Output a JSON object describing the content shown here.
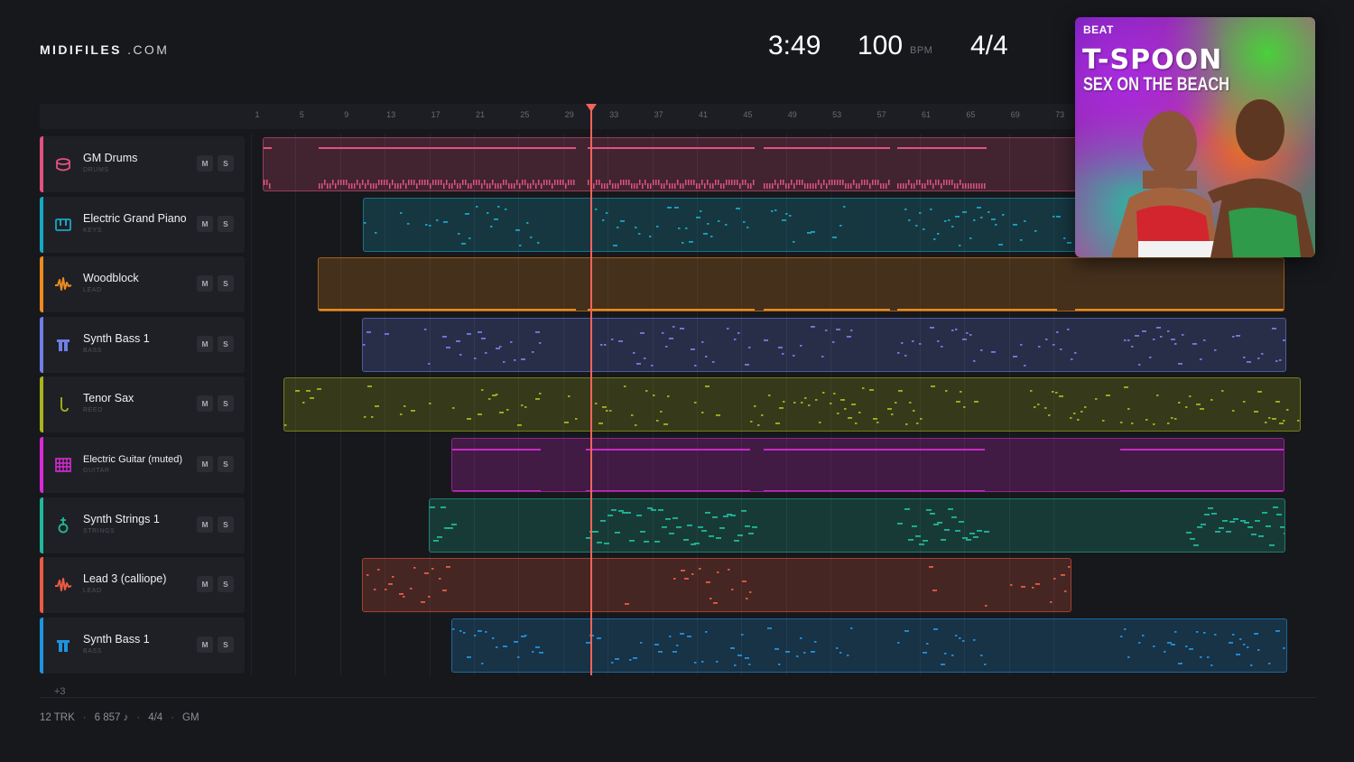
{
  "header": {
    "logo_brand": "MIDIFILES",
    "logo_tld": ".COM",
    "time": "3:49",
    "bpm": "100",
    "bpm_label": "BPM",
    "time_signature": "4/4"
  },
  "ruler": {
    "ticks": [
      "1",
      "5",
      "9",
      "13",
      "17",
      "21",
      "25",
      "29",
      "33",
      "37",
      "41",
      "45",
      "49",
      "53",
      "57",
      "61",
      "65",
      "69",
      "73"
    ]
  },
  "playhead": {
    "bar": 30.5
  },
  "tracks": [
    {
      "name": "GM Drums",
      "category": "DRUMS",
      "color": "#e0527e",
      "icon": "drum-icon",
      "mute": "M",
      "solo": "S"
    },
    {
      "name": "Electric Grand Piano",
      "category": "KEYS",
      "color": "#17a7c4",
      "icon": "piano-icon",
      "mute": "M",
      "solo": "S"
    },
    {
      "name": "Woodblock",
      "category": "LEAD",
      "color": "#ec8a1e",
      "icon": "wave-icon",
      "mute": "M",
      "solo": "S"
    },
    {
      "name": "Synth Bass 1",
      "category": "BASS",
      "color": "#6f7fe6",
      "icon": "bass-icon",
      "mute": "M",
      "solo": "S"
    },
    {
      "name": "Tenor Sax",
      "category": "REED",
      "color": "#a7b41c",
      "icon": "sax-icon",
      "mute": "M",
      "solo": "S"
    },
    {
      "name": "Electric Guitar (muted)",
      "category": "GUITAR",
      "color": "#d92ad6",
      "icon": "guitar-grid-icon",
      "mute": "M",
      "solo": "S"
    },
    {
      "name": "Synth Strings 1",
      "category": "STRINGS",
      "color": "#1fb89a",
      "icon": "strings-icon",
      "mute": "M",
      "solo": "S"
    },
    {
      "name": "Lead 3 (calliope)",
      "category": "LEAD",
      "color": "#ec5a42",
      "icon": "wave-icon",
      "mute": "M",
      "solo": "S"
    },
    {
      "name": "Synth Bass 1",
      "category": "BASS",
      "color": "#1f93e0",
      "icon": "bass-icon",
      "mute": "M",
      "solo": "S"
    }
  ],
  "more_tracks": "+3",
  "footer": {
    "tracks": "12 TRK",
    "notes": "6 857 ♪",
    "signature": "4/4",
    "standard": "GM"
  },
  "cover": {
    "label": "BEAT",
    "artist": "T-SPOON",
    "title": "SEX ON THE BEACH"
  }
}
